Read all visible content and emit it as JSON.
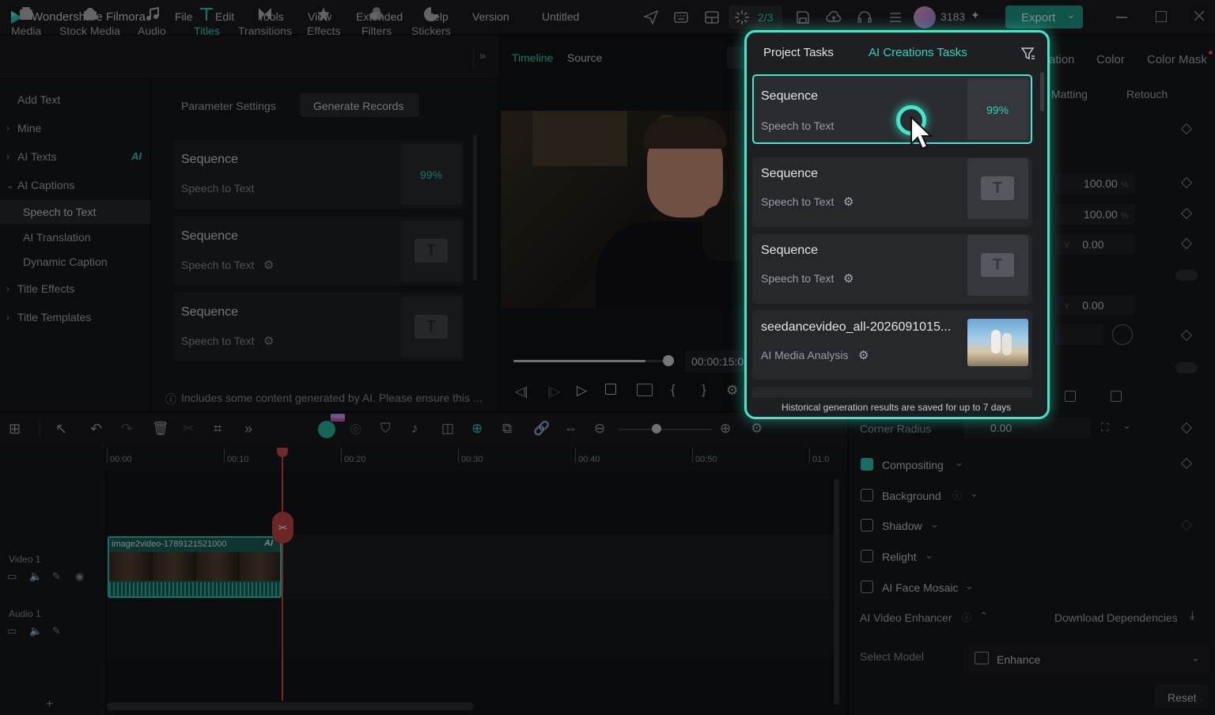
{
  "app": {
    "name": "Wondershare Filmora",
    "menu": [
      "File",
      "Edit",
      "Tools",
      "View",
      "Extended",
      "Help",
      "Version"
    ],
    "project_title": "Untitled",
    "task_counter": "2/3",
    "credits": "3183",
    "export_label": "Export"
  },
  "ribbon": {
    "tabs": [
      {
        "label": "Media",
        "icon": "media-icon"
      },
      {
        "label": "Stock Media",
        "icon": "stock-media-icon"
      },
      {
        "label": "Audio",
        "icon": "audio-icon"
      },
      {
        "label": "Titles",
        "icon": "titles-icon",
        "active": true
      },
      {
        "label": "Transitions",
        "icon": "transitions-icon"
      },
      {
        "label": "Effects",
        "icon": "effects-icon"
      },
      {
        "label": "Filters",
        "icon": "filters-icon"
      },
      {
        "label": "Stickers",
        "icon": "stickers-icon"
      }
    ]
  },
  "leftnav": {
    "add_text": "Add Text",
    "mine": "Mine",
    "ai_texts": "AI Texts",
    "ai_badge": "AI",
    "ai_captions": "AI Captions",
    "speech_to_text": "Speech to Text",
    "ai_translation": "AI Translation",
    "dynamic_caption": "Dynamic Caption",
    "title_effects": "Title Effects",
    "title_templates": "Title Templates"
  },
  "records": {
    "tab_params": "Parameter Settings",
    "tab_records": "Generate Records",
    "items": [
      {
        "title": "Sequence",
        "sub": "Speech to Text",
        "progress": "99%"
      },
      {
        "title": "Sequence",
        "sub": "Speech to Text"
      },
      {
        "title": "Sequence",
        "sub": "Speech to Text"
      }
    ],
    "notice": "Includes some content generated by AI. Please ensure this ..."
  },
  "preview": {
    "tab_timeline": "Timeline",
    "tab_source": "Source",
    "timecode": "00:00:15:0",
    "playback_progress": 0.85
  },
  "popup": {
    "tab_project": "Project Tasks",
    "tab_ai": "AI Creations Tasks",
    "items": [
      {
        "title": "Sequence",
        "sub": "Speech to Text",
        "progress": "99%"
      },
      {
        "title": "Sequence",
        "sub": "Speech to Text"
      },
      {
        "title": "Sequence",
        "sub": "Speech to Text"
      },
      {
        "title": "seedancevideo_all-2026091015...",
        "sub": "AI Media Analysis"
      }
    ],
    "footer": "Historical generation results are saved for up to 7 days"
  },
  "rightpanel": {
    "tabs": [
      "ation",
      "Color",
      "Color Mask"
    ],
    "subtabs": [
      "l Matting",
      "Retouch"
    ],
    "scale_x": "100.00",
    "scale_y": "100.00",
    "unit": "%",
    "pos_y_label": "Y",
    "pos_y": "0.00",
    "rot_y": "0.00",
    "corner_radius_label": "Corner Radius",
    "corner_radius": "0.00",
    "compositing": "Compositing",
    "background": "Background",
    "shadow": "Shadow",
    "relight": "Relight",
    "ai_face_mosaic": "AI Face Mosaic",
    "ai_video_enhancer": "AI Video Enhancer",
    "download_deps": "Download Dependencies",
    "select_model": "Select Model",
    "model_value": "Enhance",
    "reset": "Reset"
  },
  "timeline": {
    "ticks": [
      "00:00",
      "00:10",
      "00:20",
      "00:30",
      "00:40",
      "00:50",
      "01:0"
    ],
    "clip_name": "image2video-1789121521000",
    "clip_badge": "AI",
    "free_badge": "FREE",
    "video_track": "Video 1",
    "audio_track": "Audio 1"
  },
  "colors": {
    "accent": "#31d3bb",
    "glow": "#3ee8c9",
    "export_bg": "#1e9c88"
  }
}
